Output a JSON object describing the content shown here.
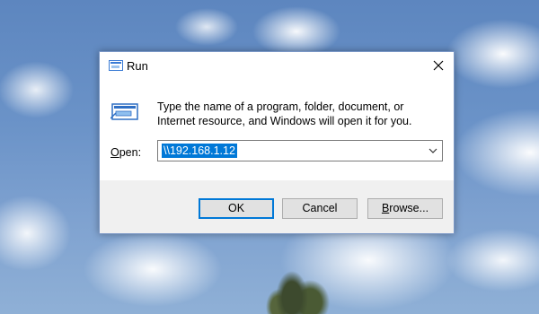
{
  "dialog": {
    "title": "Run",
    "description": "Type the name of a program, folder, document, or Internet resource, and Windows will open it for you.",
    "open_label_accel": "O",
    "open_label_rest": "pen:",
    "input_value": "\\\\192.168.1.12",
    "buttons": {
      "ok": "OK",
      "cancel": "Cancel",
      "browse_accel": "B",
      "browse_rest": "rowse..."
    }
  },
  "icons": {
    "title": "run-icon",
    "close": "close-icon",
    "dropdown": "chevron-down-icon"
  },
  "colors": {
    "selection": "#0078d7",
    "dialog_bg": "#f0f0f0",
    "button_bg": "#e1e1e1"
  }
}
